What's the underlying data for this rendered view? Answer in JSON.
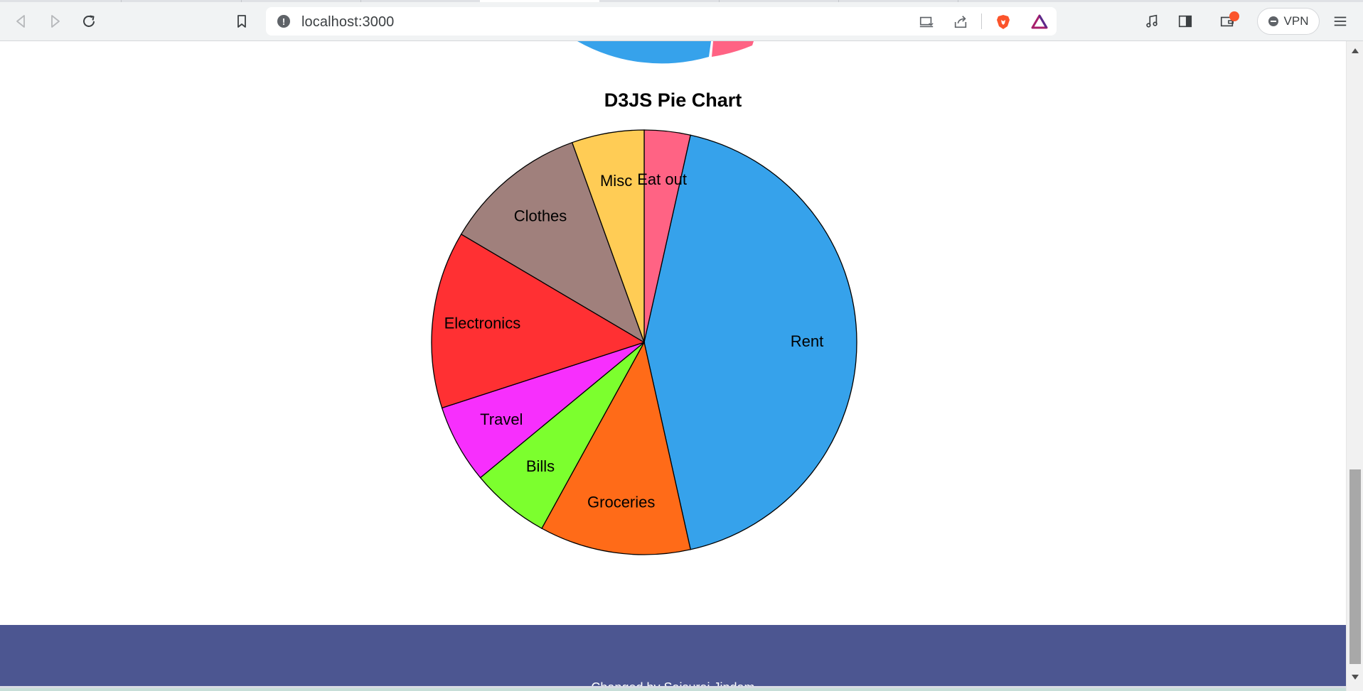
{
  "browser": {
    "url": "localhost:3000",
    "vpn_label": "VPN"
  },
  "page": {
    "chart_title": "D3JS Pie Chart",
    "footer_text": "Changed by Saisurai Jindam"
  },
  "colors": {
    "rent": "#36a2eb",
    "groceries": "#ff6b18",
    "bills": "#7cff2e",
    "travel": "#f72ffd",
    "electronics": "#ff3033",
    "clothes": "#a0807c",
    "misc": "#ffcc55",
    "eat_out": "#ff6384",
    "footer": "#4c5691"
  },
  "chart_data": {
    "type": "pie",
    "title": "D3JS Pie Chart",
    "slices": [
      {
        "label": "Eat out",
        "value": 3.5,
        "color": "#ff6384"
      },
      {
        "label": "Rent",
        "value": 43,
        "color": "#36a2eb"
      },
      {
        "label": "Groceries",
        "value": 11.5,
        "color": "#ff6b18"
      },
      {
        "label": "Bills",
        "value": 6,
        "color": "#7cff2e"
      },
      {
        "label": "Travel",
        "value": 6,
        "color": "#f72ffd"
      },
      {
        "label": "Electronics",
        "value": 13.5,
        "color": "#ff3033"
      },
      {
        "label": "Clothes",
        "value": 11,
        "color": "#a0807c"
      },
      {
        "label": "Misc",
        "value": 5.5,
        "color": "#ffcc55"
      }
    ]
  }
}
